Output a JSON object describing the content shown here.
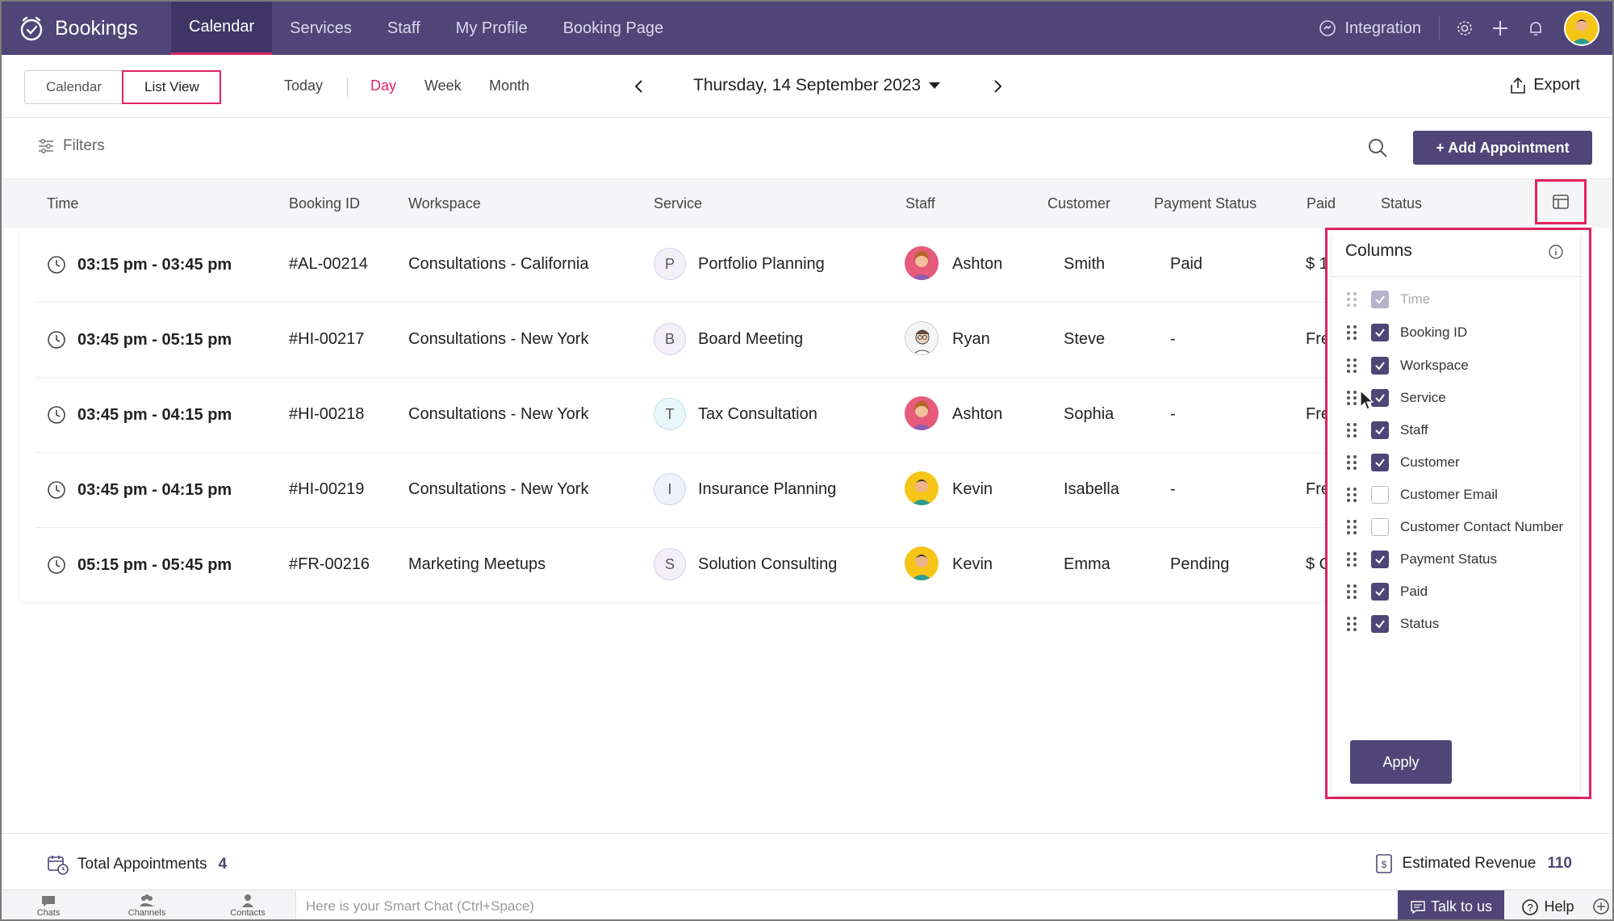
{
  "app": {
    "name": "Bookings"
  },
  "nav": {
    "tabs": [
      {
        "label": "Calendar",
        "active": true
      },
      {
        "label": "Services"
      },
      {
        "label": "Staff"
      },
      {
        "label": "My Profile"
      },
      {
        "label": "Booking Page"
      }
    ],
    "integration": "Integration"
  },
  "toolbar": {
    "view_calendar": "Calendar",
    "view_list": "List View",
    "today": "Today",
    "periods": [
      "Day",
      "Week",
      "Month"
    ],
    "active_period": "Day",
    "date": "Thursday, 14 September 2023",
    "export": "Export"
  },
  "filters": {
    "label": "Filters",
    "add_button": "+ Add Appointment"
  },
  "table": {
    "headers": [
      "Time",
      "Booking ID",
      "Workspace",
      "Service",
      "Staff",
      "Customer",
      "Payment Status",
      "Paid",
      "Status"
    ],
    "rows": [
      {
        "time": "03:15 pm - 03:45 pm",
        "id": "#AL-00214",
        "workspace": "Consultations - California",
        "service_initial": "P",
        "service": "Portfolio Planning",
        "staff": "Ashton",
        "customer": "Smith",
        "payment": "Paid",
        "paid": "$ 1"
      },
      {
        "time": "03:45 pm - 05:15 pm",
        "id": "#HI-00217",
        "workspace": "Consultations - New York",
        "service_initial": "B",
        "service": "Board Meeting",
        "staff": "Ryan",
        "customer": "Steve",
        "payment": "-",
        "paid": "Fre"
      },
      {
        "time": "03:45 pm - 04:15 pm",
        "id": "#HI-00218",
        "workspace": "Consultations - New York",
        "service_initial": "T",
        "service": "Tax Consultation",
        "staff": "Ashton",
        "customer": "Sophia",
        "payment": "-",
        "paid": "Fre"
      },
      {
        "time": "03:45 pm - 04:15 pm",
        "id": "#HI-00219",
        "workspace": "Consultations - New York",
        "service_initial": "I",
        "service": "Insurance Planning",
        "staff": "Kevin",
        "customer": "Isabella",
        "payment": "-",
        "paid": "Fre"
      },
      {
        "time": "05:15 pm - 05:45 pm",
        "id": "#FR-00216",
        "workspace": "Marketing Meetups",
        "service_initial": "S",
        "service": "Solution Consulting",
        "staff": "Kevin",
        "customer": "Emma",
        "payment": "Pending",
        "paid": "$ C"
      }
    ]
  },
  "columns_panel": {
    "title": "Columns",
    "items": [
      {
        "label": "Time",
        "checked": true,
        "disabled": true
      },
      {
        "label": "Booking ID",
        "checked": true
      },
      {
        "label": "Workspace",
        "checked": true
      },
      {
        "label": "Service",
        "checked": true
      },
      {
        "label": "Staff",
        "checked": true
      },
      {
        "label": "Customer",
        "checked": true
      },
      {
        "label": "Customer Email",
        "checked": false
      },
      {
        "label": "Customer Contact Number",
        "checked": false
      },
      {
        "label": "Payment Status",
        "checked": true
      },
      {
        "label": "Paid",
        "checked": true
      },
      {
        "label": "Status",
        "checked": true
      }
    ],
    "apply": "Apply"
  },
  "footer": {
    "total_label": "Total Appointments",
    "total_value": "4",
    "revenue_label": "Estimated Revenue",
    "revenue_value": "110"
  },
  "chatbar": {
    "items": [
      "Chats",
      "Channels",
      "Contacts"
    ],
    "placeholder": "Here is your Smart Chat (Ctrl+Space)",
    "talk": "Talk to us",
    "help": "Help"
  },
  "colors": {
    "brand": "#4f4576",
    "accent": "#e0245e"
  }
}
